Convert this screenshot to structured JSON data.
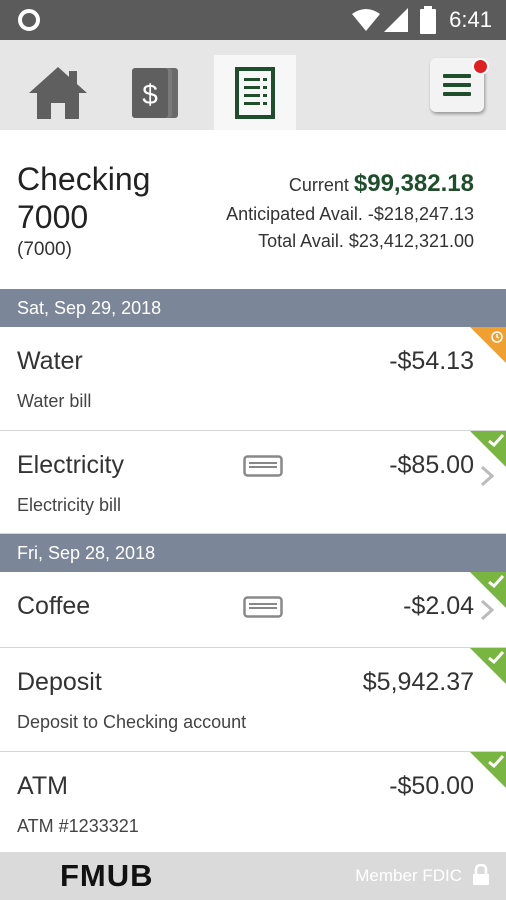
{
  "status_bar": {
    "time": "6:41",
    "icons": [
      "circle-icon",
      "wifi-icon",
      "cell-signal-icon",
      "battery-icon"
    ]
  },
  "tabs": [
    {
      "name": "home",
      "icon": "home-icon"
    },
    {
      "name": "transfers",
      "icon": "dollar-bill-icon"
    },
    {
      "name": "accounts",
      "icon": "statement-icon",
      "active": true
    }
  ],
  "menu": {
    "icon": "hamburger-menu-icon",
    "badge_color": "#e02020"
  },
  "account": {
    "name": "Checking 7000",
    "number": "(7000)",
    "current_label": "Current",
    "current_value": "$99,382.18",
    "anticipated_label": "Anticipated Avail.",
    "anticipated_value": "-$218,247.13",
    "total_label": "Total Avail.",
    "total_value": "$23,412,321.00"
  },
  "groups": [
    {
      "date": "Sat, Sep 29, 2018",
      "transactions": [
        {
          "title": "Water",
          "description": "Water bill",
          "amount": "-$54.13",
          "status": "pending"
        },
        {
          "title": "Electricity",
          "description": "Electricity bill",
          "amount": "-$85.00",
          "status": "cleared"
        }
      ]
    },
    {
      "date": "Fri, Sep 28, 2018",
      "transactions": [
        {
          "title": "Coffee",
          "description": "",
          "amount": "-$2.04",
          "status": "cleared"
        },
        {
          "title": "Deposit",
          "description": "Deposit to Checking account",
          "amount": "$5,942.37",
          "status": "cleared"
        },
        {
          "title": "ATM",
          "description": "ATM #1233321",
          "amount": "-$50.00",
          "status": "cleared"
        }
      ]
    }
  ],
  "footer": {
    "brand": "FMUB",
    "member": "Member FDIC"
  },
  "colors": {
    "status_bar": "#5b5b5b",
    "accent_green": "#1f4e2c",
    "cleared": "#78b541",
    "pending": "#f0a030",
    "date_header": "#7b8798"
  }
}
